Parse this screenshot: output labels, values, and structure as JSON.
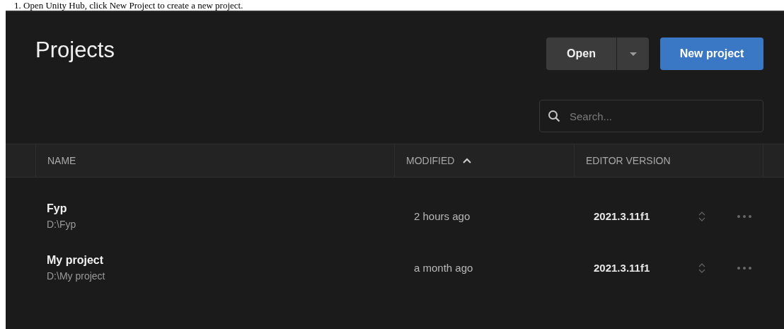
{
  "caption": "1.   Open Unity Hub, click New Project to create a new project.",
  "header": {
    "title": "Projects",
    "open_button": "Open",
    "new_button": "New project"
  },
  "search": {
    "placeholder": "Search..."
  },
  "table": {
    "columns": [
      {
        "label": "NAME",
        "sorted": false
      },
      {
        "label": "MODIFIED",
        "sorted": true
      },
      {
        "label": "EDITOR VERSION",
        "sorted": false
      }
    ],
    "rows": [
      {
        "name": "Fyp",
        "path": "D:\\Fyp",
        "modified": "2 hours ago",
        "version": "2021.3.11f1"
      },
      {
        "name": "My project",
        "path": "D:\\My project",
        "modified": "a month ago",
        "version": "2021.3.11f1"
      }
    ]
  }
}
